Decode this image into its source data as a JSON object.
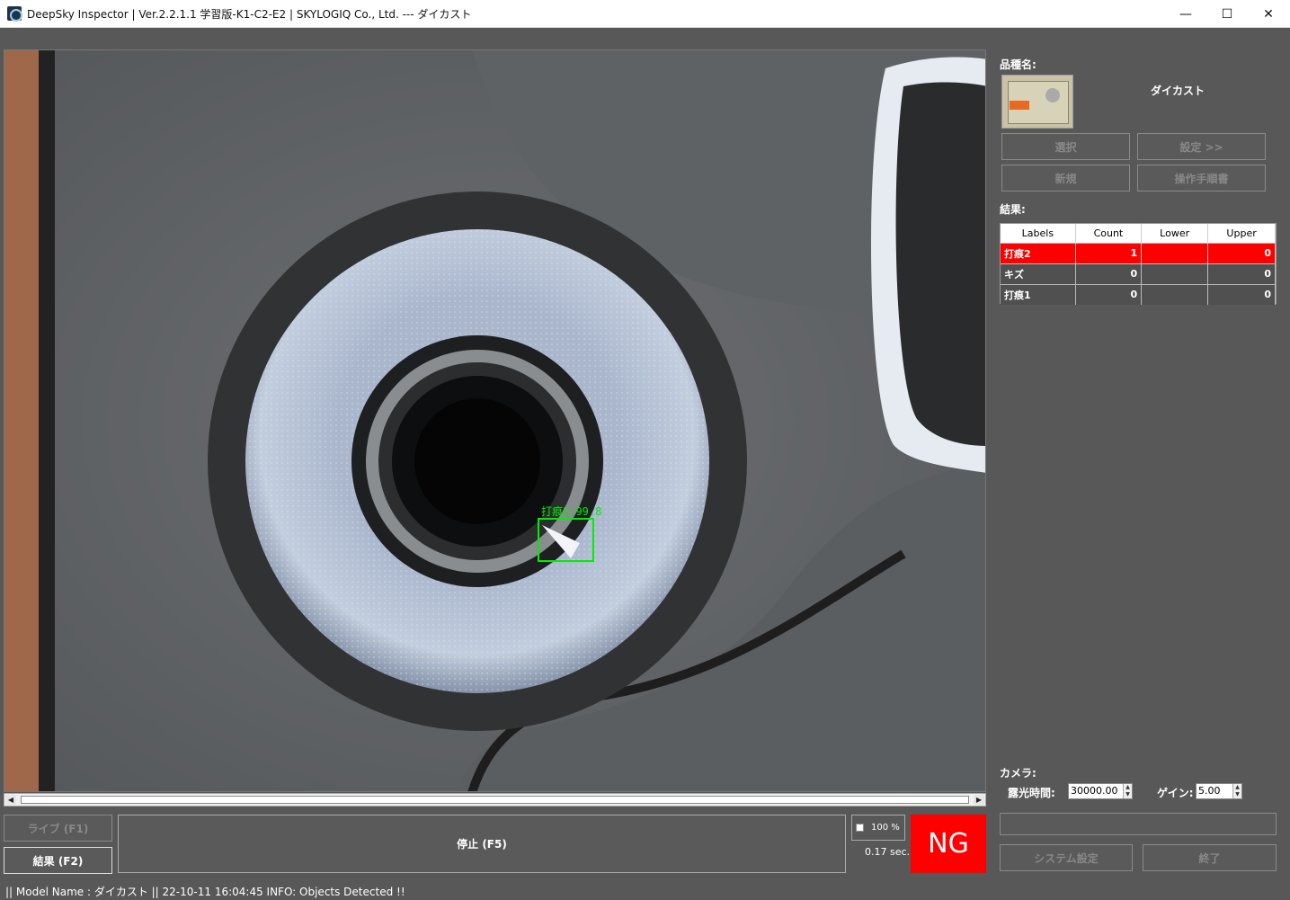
{
  "window": {
    "title": "DeepSky Inspector | Ver.2.2.1.1 学習版-K1-C2-E2 | SKYLOGIQ Co., Ltd. --- ダイカスト",
    "minimize": "—",
    "maximize": "☐",
    "close": "✕"
  },
  "viewer": {
    "detection_label": "打痕2:99.8",
    "detection_color": "#00ee00"
  },
  "product": {
    "label": "品種名:",
    "name": "ダイカスト",
    "select_button": "選択",
    "settings_button": "設定 >>",
    "new_button": "新規",
    "manual_button": "操作手順書"
  },
  "results": {
    "label": "結果:",
    "columns": [
      "Labels",
      "Count",
      "Lower",
      "Upper"
    ],
    "rows": [
      {
        "label": "打痕2",
        "count": "1",
        "lower": "",
        "upper": "0",
        "status": "ng"
      },
      {
        "label": "キズ",
        "count": "0",
        "lower": "",
        "upper": "0",
        "status": "ok"
      },
      {
        "label": "打痕1",
        "count": "0",
        "lower": "",
        "upper": "0",
        "status": "ok"
      }
    ]
  },
  "camera": {
    "label": "カメラ:",
    "exposure_label": "露光時間:",
    "exposure_value": "30000.00",
    "gain_label": "ゲイン:",
    "gain_value": "5.00"
  },
  "controls": {
    "live_button": "ライブ (F1)",
    "result_button": "結果 (F2)",
    "stop_button": "停止 (F5)",
    "zoom_value": "100 %",
    "elapsed": "0.17 sec.",
    "judgement": "NG",
    "system_settings_button": "システム設定",
    "exit_button": "終了"
  },
  "status": {
    "text": "|| Model Name : ダイカスト ||    22-10-11 16:04:45   INFO:   Objects Detected !!"
  }
}
